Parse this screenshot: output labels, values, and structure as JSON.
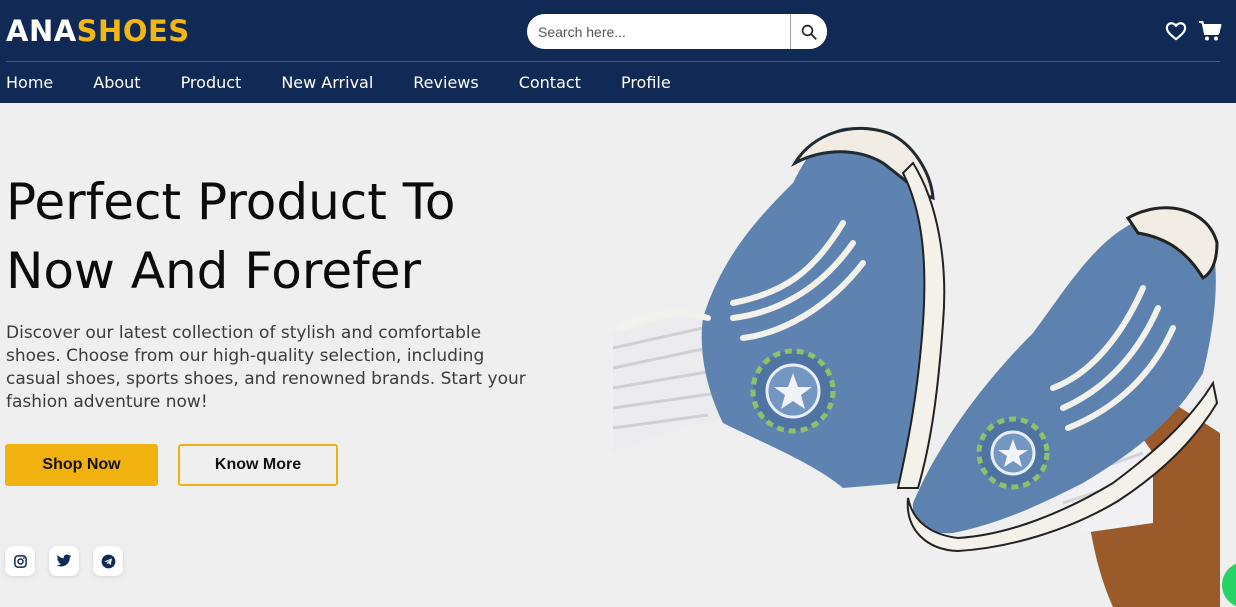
{
  "brand": {
    "part1": "ANA",
    "part2": "SHOES",
    "color_primary": "#ffffff",
    "color_accent": "#f2b713"
  },
  "search": {
    "placeholder": "Search here...",
    "icon": "search-icon"
  },
  "header_icons": [
    "heart-icon",
    "cart-icon"
  ],
  "nav": {
    "items": [
      "Home",
      "About",
      "Product",
      "New Arrival",
      "Reviews",
      "Contact",
      "Profile"
    ]
  },
  "hero": {
    "title_line1": "Perfect Product To",
    "title_line2": "Now And Forefer",
    "description": "Discover our latest collection of stylish and comfortable shoes. Choose from our high-quality selection, including casual shoes, sports shoes, and renowned brands. Start your fashion adventure now!",
    "shop_label": "Shop Now",
    "know_label": "Know More"
  },
  "socials": [
    "instagram-icon",
    "twitter-icon",
    "telegram-icon"
  ],
  "colors": {
    "header_bg": "#112955",
    "accent": "#f1b20f",
    "page_bg": "#efefef",
    "chat": "#25d366"
  }
}
